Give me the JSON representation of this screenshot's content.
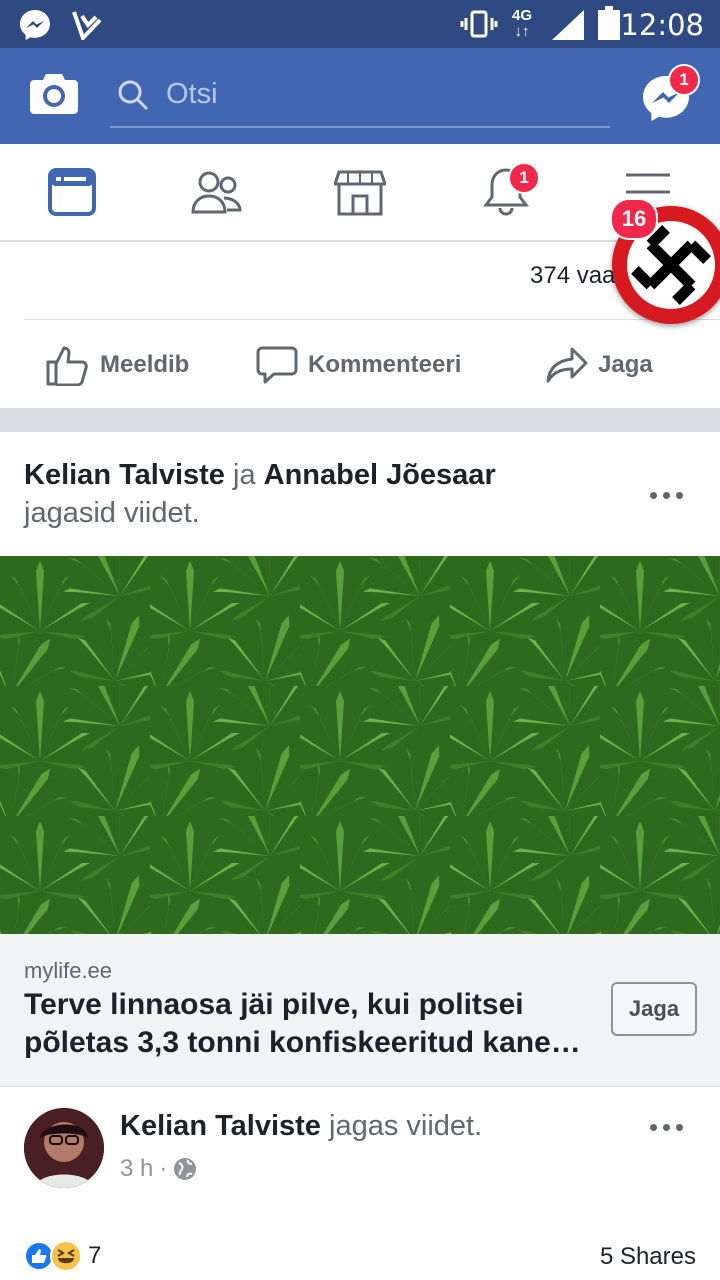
{
  "status_bar": {
    "time": "12:08",
    "network": "4G",
    "icons": [
      "messenger-icon",
      "check-app-icon",
      "vibrate-icon",
      "signal-icon",
      "battery-icon"
    ]
  },
  "header": {
    "search_placeholder": "Otsi",
    "messenger_badge": "1",
    "brand_color": "#4267b2"
  },
  "nav": {
    "tabs": [
      "news-feed-icon",
      "friends-icon",
      "marketplace-icon",
      "notifications-icon",
      "menu-icon"
    ],
    "notifications_badge": "1"
  },
  "chat_head": {
    "badge": "16"
  },
  "post1": {
    "reaction_count": "374 vaa",
    "actions": {
      "like": "Meeldib",
      "comment": "Kommenteeri",
      "share": "Jaga"
    }
  },
  "post2": {
    "author1": "Kelian Talviste",
    "conj": " ja ",
    "author2": "Annabel Jõesaar",
    "action": "jagasid viidet.",
    "link": {
      "domain": "mylife.ee",
      "title": "Terve linnaosa jäi pilve, kui politsei põletas 3,3 tonni konfiskeeritud kane…",
      "share_button": "Jaga"
    }
  },
  "post3": {
    "author": "Kelian Talviste",
    "action": " jagas viidet.",
    "time": "3 h",
    "reaction_count": "7",
    "shares": "5 Shares"
  }
}
